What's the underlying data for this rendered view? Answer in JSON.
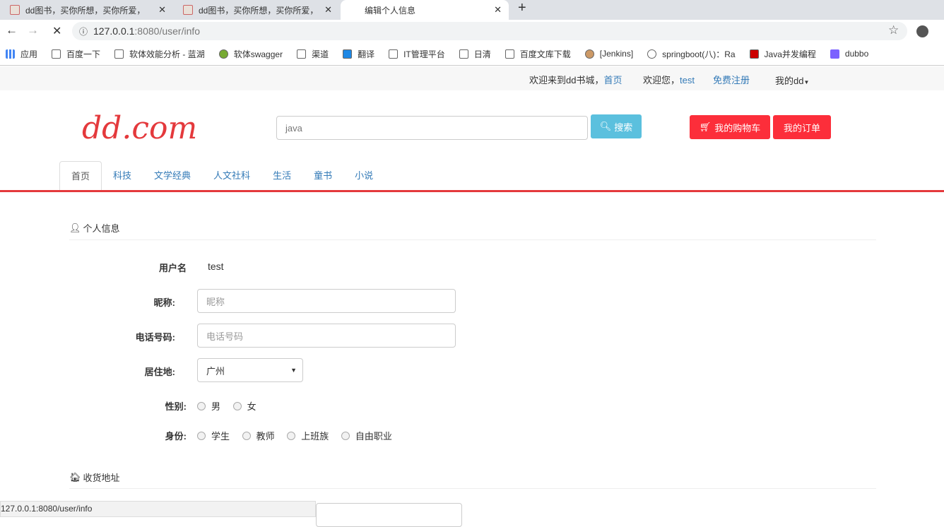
{
  "browser": {
    "tabs": [
      {
        "title": "dd图书，买你所想，买你所爱，"
      },
      {
        "title": "dd图书，买你所想，买你所爱，"
      },
      {
        "title": "编辑个人信息"
      }
    ],
    "url_host": "127.0.0.1",
    "url_rest": ":8080/user/info",
    "bookmarks": [
      "应用",
      "百度一下",
      "软体效能分析 - 蓝湖",
      "软体swagger",
      "渠道",
      "翻译",
      "IT管理平台",
      "日清",
      "百度文库下载",
      "[Jenkins]",
      "springboot(八)：Ra",
      "Java并发编程",
      "dubbo"
    ],
    "status_url": "127.0.0.1:8080/user/info"
  },
  "topbar": {
    "welcome": "欢迎来到dd书城，",
    "home": "首页",
    "greet": "欢迎您，",
    "user": "test",
    "register": "免费注册",
    "mydd": "我的dd"
  },
  "header": {
    "logo": "dd.com",
    "search_value": "java",
    "search_btn": "搜索",
    "cart": "我的购物车",
    "orders": "我的订单"
  },
  "nav": [
    "首页",
    "科技",
    "文学经典",
    "人文社科",
    "生活",
    "童书",
    "小说"
  ],
  "profile": {
    "section": "个人信息",
    "username_label": "用户名",
    "username": "test",
    "nickname_label": "昵称:",
    "nickname_ph": "昵称",
    "phone_label": "电话号码:",
    "phone_ph": "电话号码",
    "city_label": "居住地:",
    "city": "广州",
    "gender_label": "性别:",
    "genders": [
      "男",
      "女"
    ],
    "identity_label": "身份:",
    "identities": [
      "学生",
      "教师",
      "上班族",
      "自由职业"
    ]
  },
  "address": {
    "section": "收货地址"
  },
  "colors": {
    "accent": "#e4393c",
    "button_red": "#fc2e3a",
    "search_btn": "#5bc0de"
  }
}
